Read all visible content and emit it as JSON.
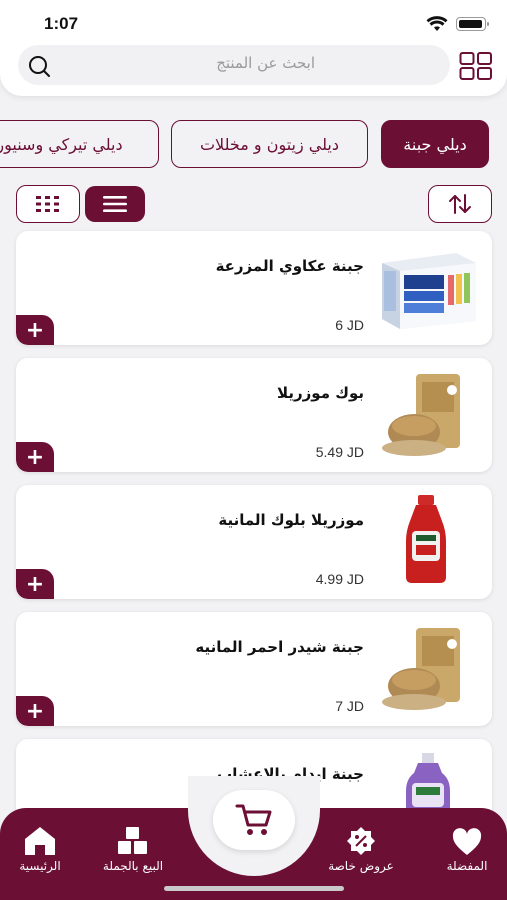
{
  "status_bar": {
    "time": "1:07"
  },
  "header": {
    "search_placeholder": "ابحث عن المنتج",
    "search_icon": "search-icon",
    "layout_icon": "grid-icon"
  },
  "categories": [
    {
      "label": "ديلي جبنة",
      "active": true
    },
    {
      "label": "ديلي زيتون و مخللات",
      "active": false
    },
    {
      "label": "ديلي تيركي وسنيور",
      "active": false
    }
  ],
  "toolbar": {
    "list_view_icon": "list-icon",
    "grid_view_icon": "grid-dots-icon",
    "sort_icon": "sort-arrows-icon"
  },
  "products": [
    {
      "name": "جبنة عكاوي المزرعة",
      "price": "6 JD",
      "image": "beer-box"
    },
    {
      "name": "بوك موزريلا",
      "price": "5.49 JD",
      "image": "seed-bag"
    },
    {
      "name": "موزريلا بلوك المانية",
      "price": "4.99 JD",
      "image": "ketchup-bottle"
    },
    {
      "name": "جبنة شيدر احمر المانيه",
      "price": "7 JD",
      "image": "seed-bag"
    },
    {
      "name": "جبنة ايدام بالاعشاب",
      "price": "",
      "image": "dish-soap-bottle"
    }
  ],
  "add_label": "+",
  "bottom_nav": {
    "favorites": "المفضلة",
    "offers": "عروض خاصة",
    "wholesale": "البيع بالجملة",
    "home": "الرئيسية"
  },
  "colors": {
    "primary": "#6b0f35",
    "background": "#f2f2f4"
  }
}
